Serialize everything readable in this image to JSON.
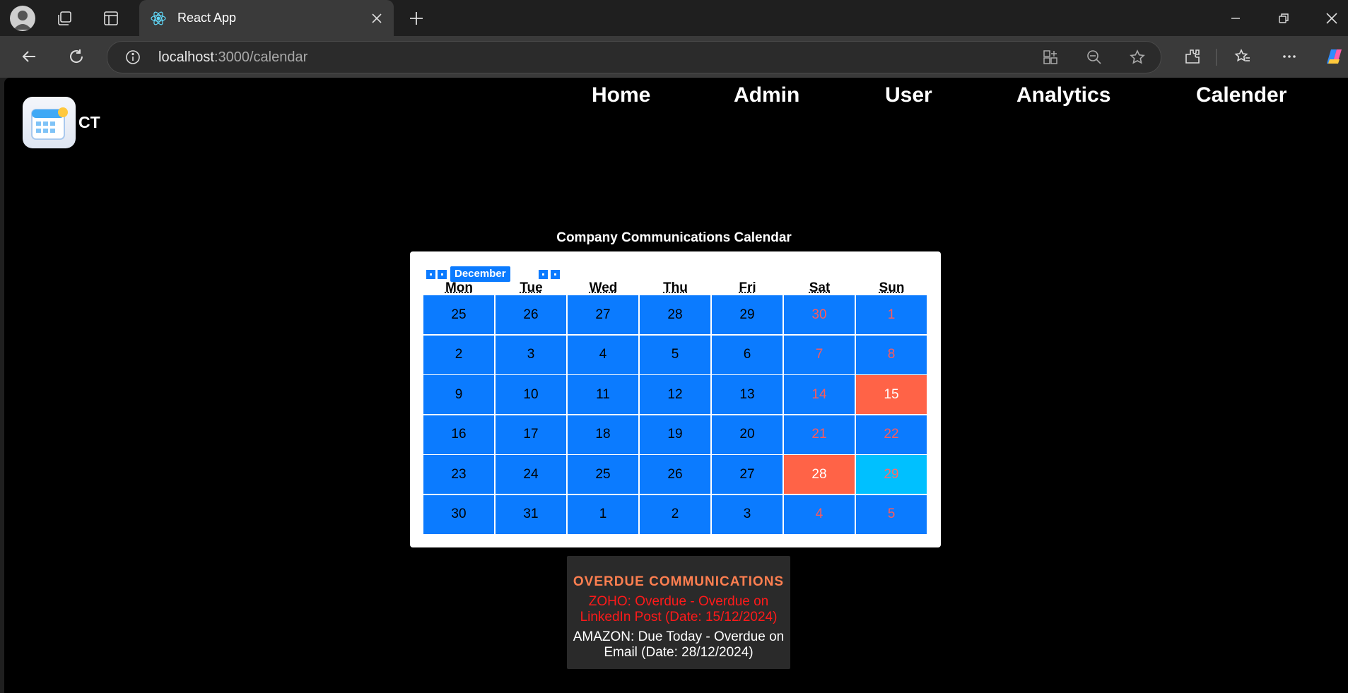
{
  "browser": {
    "tab_title": "React App",
    "url_host": "localhost",
    "url_path": ":3000/calendar"
  },
  "app": {
    "brand": "CT",
    "nav": [
      "Home",
      "Admin",
      "User",
      "Analytics",
      "Calender"
    ]
  },
  "calendar": {
    "title": "Company Communications Calendar",
    "month_label": "December 2024",
    "weekdays": [
      "Mon",
      "Tue",
      "Wed",
      "Thu",
      "Fri",
      "Sat",
      "Sun"
    ],
    "weeks": [
      [
        "25",
        "26",
        "27",
        "28",
        "29",
        "30",
        "1"
      ],
      [
        "2",
        "3",
        "4",
        "5",
        "6",
        "7",
        "8"
      ],
      [
        "9",
        "10",
        "11",
        "12",
        "13",
        "14",
        "15"
      ],
      [
        "16",
        "17",
        "18",
        "19",
        "20",
        "21",
        "22"
      ],
      [
        "23",
        "24",
        "25",
        "26",
        "27",
        "28",
        "29"
      ],
      [
        "30",
        "31",
        "1",
        "2",
        "3",
        "4",
        "5"
      ]
    ],
    "highlights": {
      "overdue": [
        "15",
        "28"
      ],
      "today": "29"
    },
    "colors": {
      "cell": "#0b7bff",
      "weekend_text": "#ff5a5a",
      "overdue": "#ff6347",
      "today": "#00c0ff"
    }
  },
  "overdue": {
    "title": "OVERDUE COMMUNICATIONS",
    "items": [
      {
        "text": "ZOHO: Overdue - Overdue on LinkedIn Post (Date: 15/12/2024)",
        "color": "#ff1a1a"
      },
      {
        "text": "AMAZON: Due Today - Overdue on Email (Date: 28/12/2024)",
        "color": "#ffffff"
      }
    ]
  }
}
